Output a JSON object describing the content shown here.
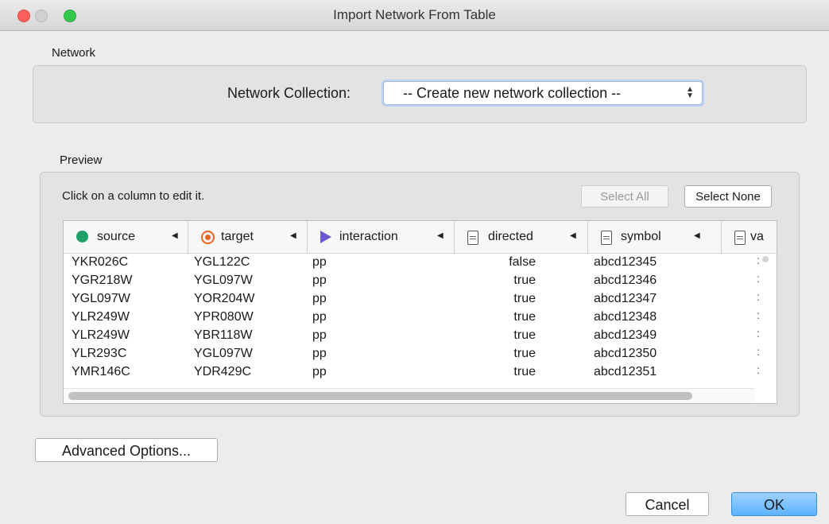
{
  "window": {
    "title": "Import Network From Table"
  },
  "network": {
    "section_label": "Network",
    "collection_label": "Network Collection:",
    "collection_value": "-- Create new network collection --"
  },
  "preview": {
    "section_label": "Preview",
    "hint": "Click on a column to edit it.",
    "select_all_label": "Select All",
    "select_none_label": "Select None",
    "columns": [
      {
        "label": "source",
        "icon": "source-node-icon",
        "color": "#1f9e69"
      },
      {
        "label": "target",
        "icon": "target-node-icon",
        "color": "#e8651f"
      },
      {
        "label": "interaction",
        "icon": "interaction-icon",
        "color": "#6b5bd0"
      },
      {
        "label": "directed",
        "icon": "document-icon"
      },
      {
        "label": "symbol",
        "icon": "document-icon"
      },
      {
        "label": "va",
        "icon": "document-icon"
      }
    ],
    "rows": [
      [
        "YKR026C",
        "YGL122C",
        "pp",
        "false",
        "abcd12345"
      ],
      [
        "YGR218W",
        "YGL097W",
        "pp",
        "true",
        "abcd12346"
      ],
      [
        "YGL097W",
        "YOR204W",
        "pp",
        "true",
        "abcd12347"
      ],
      [
        "YLR249W",
        "YPR080W",
        "pp",
        "true",
        "abcd12348"
      ],
      [
        "YLR249W",
        "YBR118W",
        "pp",
        "true",
        "abcd12349"
      ],
      [
        "YLR293C",
        "YGL097W",
        "pp",
        "true",
        "abcd12350"
      ],
      [
        "YMR146C",
        "YDR429C",
        "pp",
        "true",
        "abcd12351"
      ]
    ]
  },
  "footer": {
    "advanced_label": "Advanced Options...",
    "cancel_label": "Cancel",
    "ok_label": "OK"
  }
}
